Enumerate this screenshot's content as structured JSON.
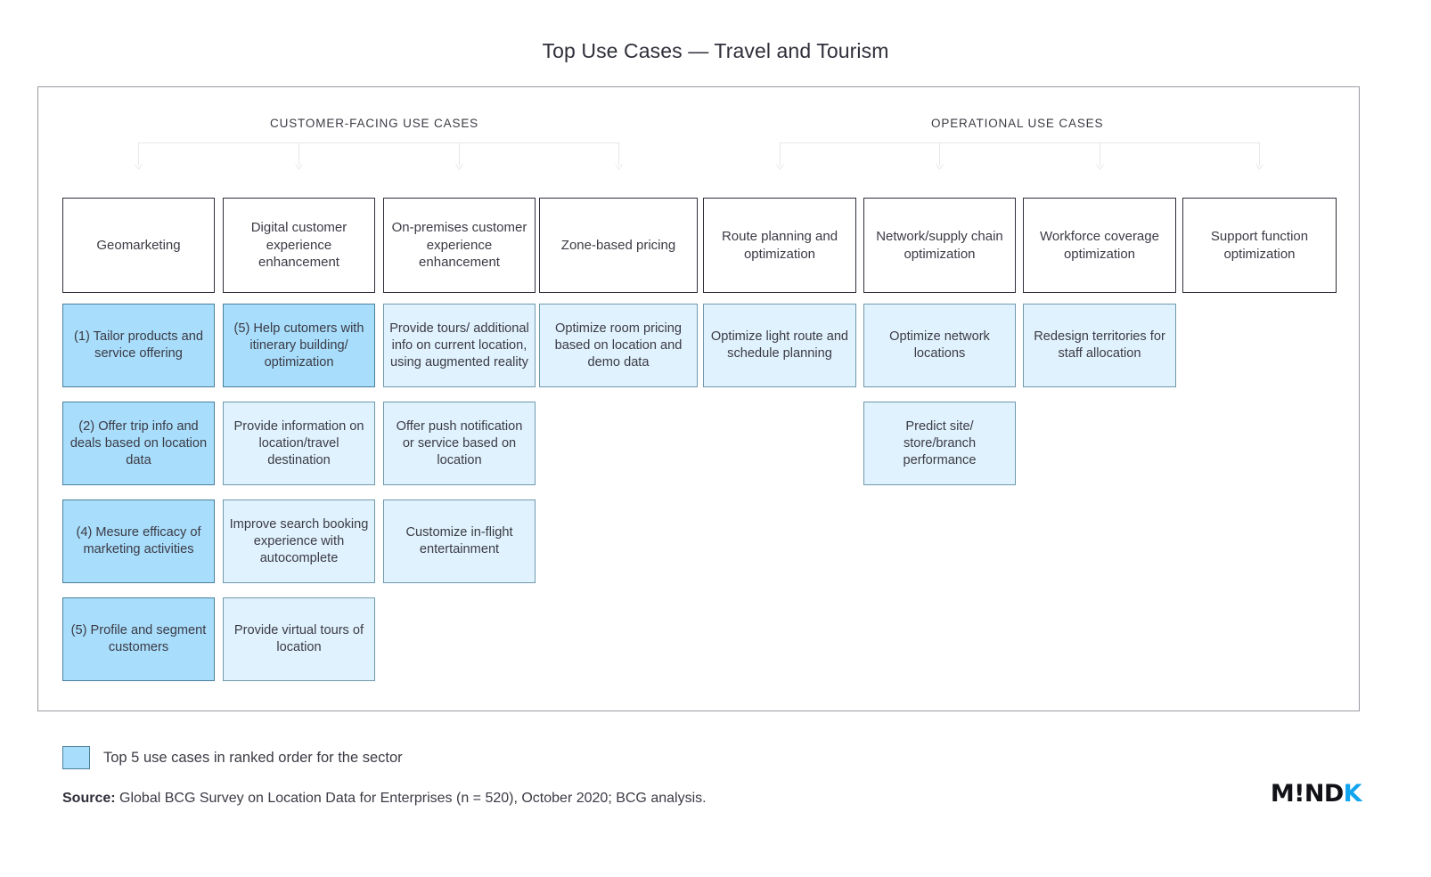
{
  "title": "Top Use Cases — Travel and Tourism",
  "groups": [
    {
      "label": "CUSTOMER-FACING USE CASES",
      "columns": 4
    },
    {
      "label": "OPERATIONAL USE CASES",
      "columns": 4
    }
  ],
  "columns": [
    {
      "header": "Geomarketing",
      "cells": [
        {
          "text": "(1) Tailor products and service offering",
          "ranked": true
        },
        {
          "text": "(2) Offer trip info and deals based on location data",
          "ranked": true
        },
        {
          "text": "(4) Mesure efficacy of marketing activities",
          "ranked": true
        },
        {
          "text": "(5) Profile and segment customers",
          "ranked": true
        }
      ]
    },
    {
      "header": "Digital customer experience enhancement",
      "cells": [
        {
          "text": "(5) Help cutomers with itinerary building/ optimization",
          "ranked": true
        },
        {
          "text": "Provide information on location/travel destination",
          "ranked": false
        },
        {
          "text": "Improve search booking experience with autocomplete",
          "ranked": false
        },
        {
          "text": "Provide virtual tours of location",
          "ranked": false
        }
      ]
    },
    {
      "header": "On-premises customer experience enhancement",
      "cells": [
        {
          "text": "Provide tours/ additional info on current location, using augmented reality",
          "ranked": false
        },
        {
          "text": "Offer push notification or service based on location",
          "ranked": false
        },
        {
          "text": "Customize in-flight entertainment",
          "ranked": false
        }
      ]
    },
    {
      "header": "Zone-based pricing",
      "cells": [
        {
          "text": "Optimize room pricing based on location and demo data",
          "ranked": false
        }
      ]
    },
    {
      "header": "Route planning and optimization",
      "cells": [
        {
          "text": "Optimize light route and schedule planning",
          "ranked": false
        }
      ]
    },
    {
      "header": "Network/supply chain optimization",
      "cells": [
        {
          "text": "Optimize network locations",
          "ranked": false
        },
        {
          "text": "Predict site/ store/branch performance",
          "ranked": false
        }
      ]
    },
    {
      "header": "Workforce coverage optimization",
      "cells": [
        {
          "text": "Redesign territories for staff allocation",
          "ranked": false
        }
      ]
    },
    {
      "header": "Support function optimization",
      "cells": []
    }
  ],
  "legend": {
    "text": "Top 5 use cases in ranked order for the sector",
    "swatch_color": "#a8ddfb"
  },
  "source": {
    "prefix": "Source:",
    "text": " Global BCG Survey on Location Data for Enterprises (n = 520), October 2020; BCG analysis."
  },
  "logo": {
    "main": "M!ND",
    "accent": "K",
    "accent_color": "#12a5ef"
  }
}
